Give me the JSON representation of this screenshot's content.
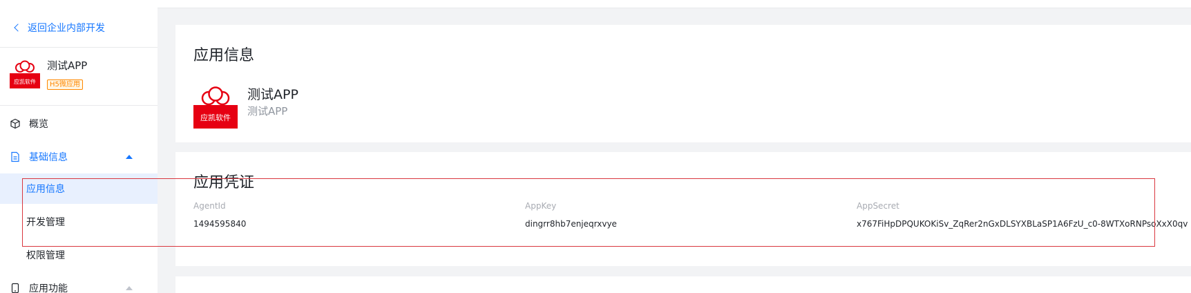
{
  "sidebar": {
    "back_label": "返回企业内部开发",
    "app": {
      "name": "测试APP",
      "badge": "H5微应用",
      "logo_text": "应凯软件"
    },
    "items": [
      {
        "label": "概览",
        "icon": "cube-icon"
      },
      {
        "label": "基础信息",
        "icon": "document-icon",
        "expanded": true
      },
      {
        "label": "应用信息",
        "selected": true
      },
      {
        "label": "开发管理"
      },
      {
        "label": "权限管理"
      },
      {
        "label": "应用功能",
        "icon": "phone-icon"
      }
    ]
  },
  "app_info": {
    "title": "应用信息",
    "logo_text": "应凯软件",
    "name": "测试APP",
    "description": "测试APP"
  },
  "credentials": {
    "title": "应用凭证",
    "fields": [
      {
        "label": "AgentId",
        "value": "1494595840"
      },
      {
        "label": "AppKey",
        "value": "dingrr8hb7enjeqrxvye"
      },
      {
        "label": "AppSecret",
        "value": "x767FiHpDPQUKOKiSv_ZqRer2nGxDLSYXBLaSP1A6FzU_c0-8WTXoRNPsoXxX0qv"
      }
    ]
  },
  "colors": {
    "accent": "#1677ff",
    "logo_red": "#e60012",
    "highlight": "#d9363e",
    "badge_orange": "#ff8800"
  }
}
